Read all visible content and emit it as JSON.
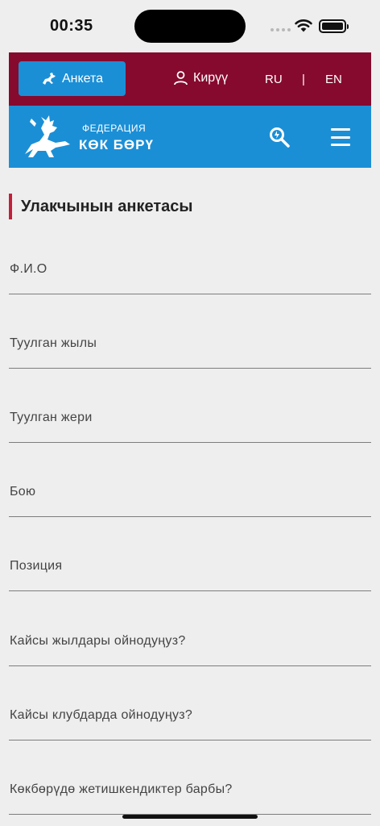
{
  "status": {
    "time": "00:35"
  },
  "top_bar": {
    "anketa_label": "Анкета",
    "login_label": "Кирүү",
    "lang_ru": "RU",
    "lang_separator": "|",
    "lang_en": "EN"
  },
  "nav": {
    "logo_top": "ФЕДЕРАЦИЯ",
    "logo_main": "КӨК БӨРҮ"
  },
  "form": {
    "title": "Улакчынын анкетасы",
    "fields": [
      {
        "label": "Ф.И.О"
      },
      {
        "label": "Туулган жылы"
      },
      {
        "label": "Туулган жери"
      },
      {
        "label": "Бою"
      },
      {
        "label": "Позиция"
      },
      {
        "label": "Кайсы жылдары ойнодуңуз?"
      },
      {
        "label": "Кайсы клубдарда ойнодуңуз?"
      },
      {
        "label": "Көкбөрүдө жетишкендиктер барбы?"
      }
    ]
  },
  "colors": {
    "top_bar": "#860a2e",
    "nav_bar": "#1b8fd6",
    "accent": "#c21f3a",
    "background": "#eeeeee"
  }
}
